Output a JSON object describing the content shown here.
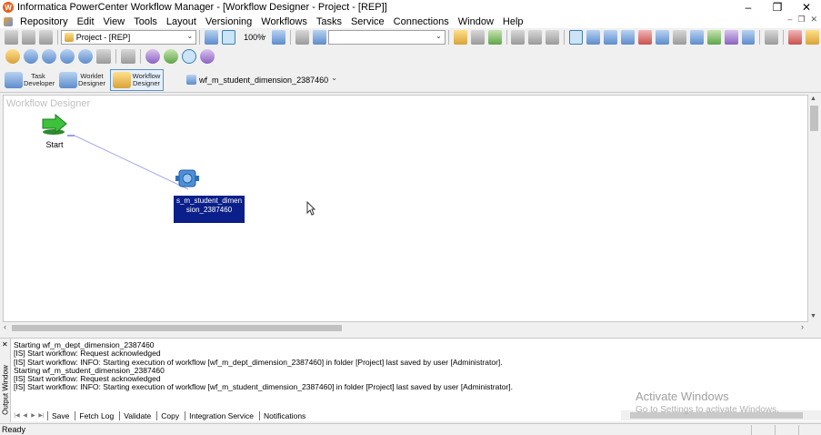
{
  "window": {
    "title": "Informatica PowerCenter Workflow Manager - [Workflow Designer - Project - [REP]]",
    "minimize": "–",
    "maximize": "❐",
    "close": "✕"
  },
  "menu": {
    "items": [
      "Repository",
      "Edit",
      "View",
      "Tools",
      "Layout",
      "Versioning",
      "Workflows",
      "Tasks",
      "Service",
      "Connections",
      "Window",
      "Help"
    ],
    "mdi_min": "–",
    "mdi_restore": "❐",
    "mdi_close": "✕"
  },
  "toolbar": {
    "folder_combo": "Project - [REP]",
    "zoom_combo": "100%",
    "search_combo": ""
  },
  "tools": {
    "task_developer": "Task Developer",
    "worklet_designer": "Worklet Designer",
    "workflow_designer": "Workflow Designer",
    "workflow_combo": "wf_m_student_dimension_2387460"
  },
  "canvas": {
    "label": "Workflow Designer",
    "start_label": "Start",
    "session_label": "s_m_student_dimension_2387460"
  },
  "output": {
    "window_label": "Output Window",
    "log_lines": [
      "Starting wf_m_dept_dimension_2387460",
      "[IS] Start workflow: Request acknowledged",
      "[IS] Start workflow: INFO: Starting execution of workflow [wf_m_dept_dimension_2387460] in folder [Project] last saved by user [Administrator].",
      "Starting wf_m_student_dimension_2387460",
      "[IS] Start workflow: Request acknowledged",
      "[IS] Start workflow: INFO: Starting execution of workflow [wf_m_student_dimension_2387460] in folder [Project] last saved by user [Administrator]."
    ],
    "tabs": [
      "Save",
      "Fetch Log",
      "Validate",
      "Copy",
      "Integration Service",
      "Notifications"
    ]
  },
  "watermark": {
    "line1": "Activate Windows",
    "line2": "Go to Settings to activate Windows."
  },
  "status": {
    "text": "Ready"
  }
}
